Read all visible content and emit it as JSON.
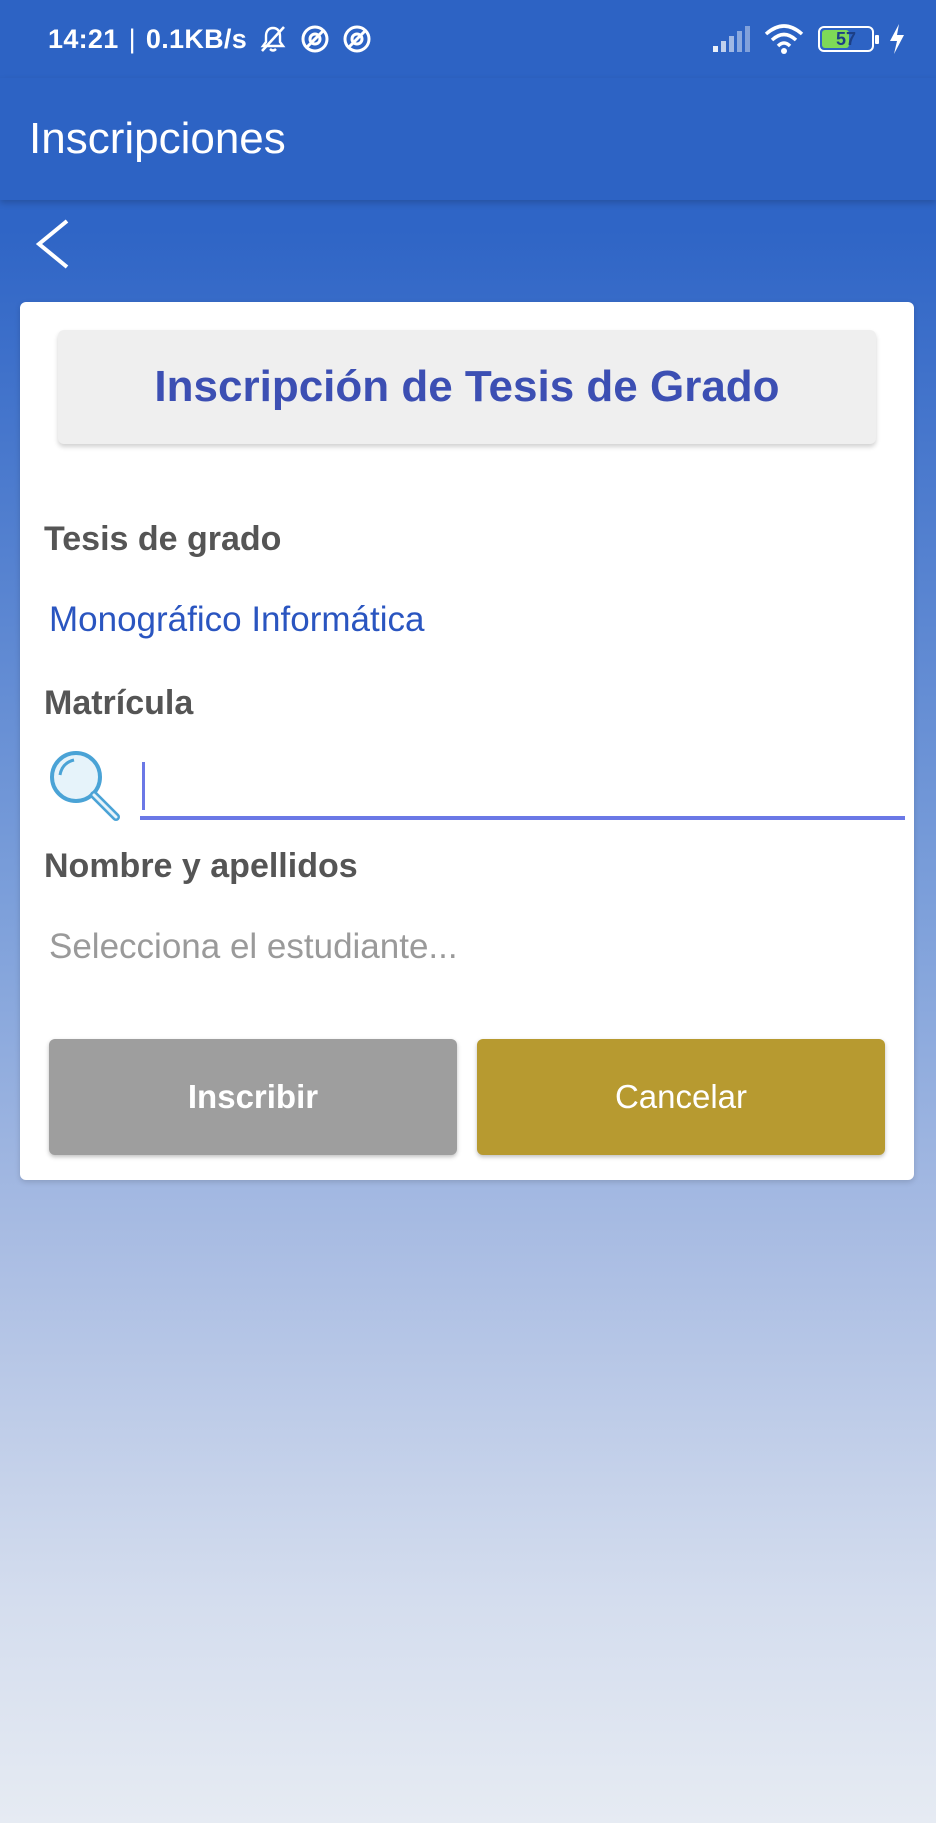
{
  "status_bar": {
    "time": "14:21",
    "separator": "|",
    "network_speed": "0.1KB/s",
    "battery_level": "57",
    "battery_fraction": 0.57
  },
  "app_bar": {
    "title": "Inscripciones"
  },
  "card": {
    "title": "Inscripción de Tesis de Grado",
    "thesis_label": "Tesis de grado",
    "thesis_value": "Monográfico Informática",
    "matricula_label": "Matrícula",
    "matricula_value": "",
    "name_label": "Nombre y apellidos",
    "name_placeholder": "Selecciona el estudiante..."
  },
  "buttons": {
    "inscribir": "Inscribir",
    "cancelar": "Cancelar"
  },
  "colors": {
    "primary": "#2d63c4",
    "title_text": "#3c4fb3",
    "link_text": "#2a55c0",
    "input_underline": "#6b78e6",
    "inscribir_bg": "#9e9e9e",
    "cancelar_bg": "#b79a30"
  },
  "icons": {
    "back": "chevron-left-icon",
    "search": "search-icon",
    "mute": "bell-off-icon",
    "signal": "signal-icon",
    "wifi": "wifi-icon",
    "battery": "battery-icon",
    "charging": "bolt-icon"
  }
}
